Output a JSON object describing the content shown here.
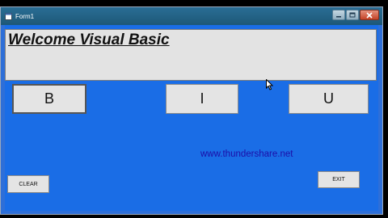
{
  "window": {
    "title": "Form1"
  },
  "textbox": {
    "value": "Welcome Visual Basic"
  },
  "buttons": {
    "bold_label": "B",
    "italic_label": "I",
    "underline_label": "U",
    "clear_label": "CLEAR",
    "exit_label": "EXIT"
  },
  "watermark": {
    "text": "www.thundershare.net"
  },
  "colors": {
    "form_background": "#1a6de6",
    "textbox_background": "#e3e3e3",
    "watermark": "#1c0ea8"
  },
  "icons": {
    "window_icon": "form-icon",
    "minimize": "minimize-icon",
    "maximize": "maximize-icon",
    "close": "close-icon",
    "cursor": "mouse-pointer-icon"
  }
}
